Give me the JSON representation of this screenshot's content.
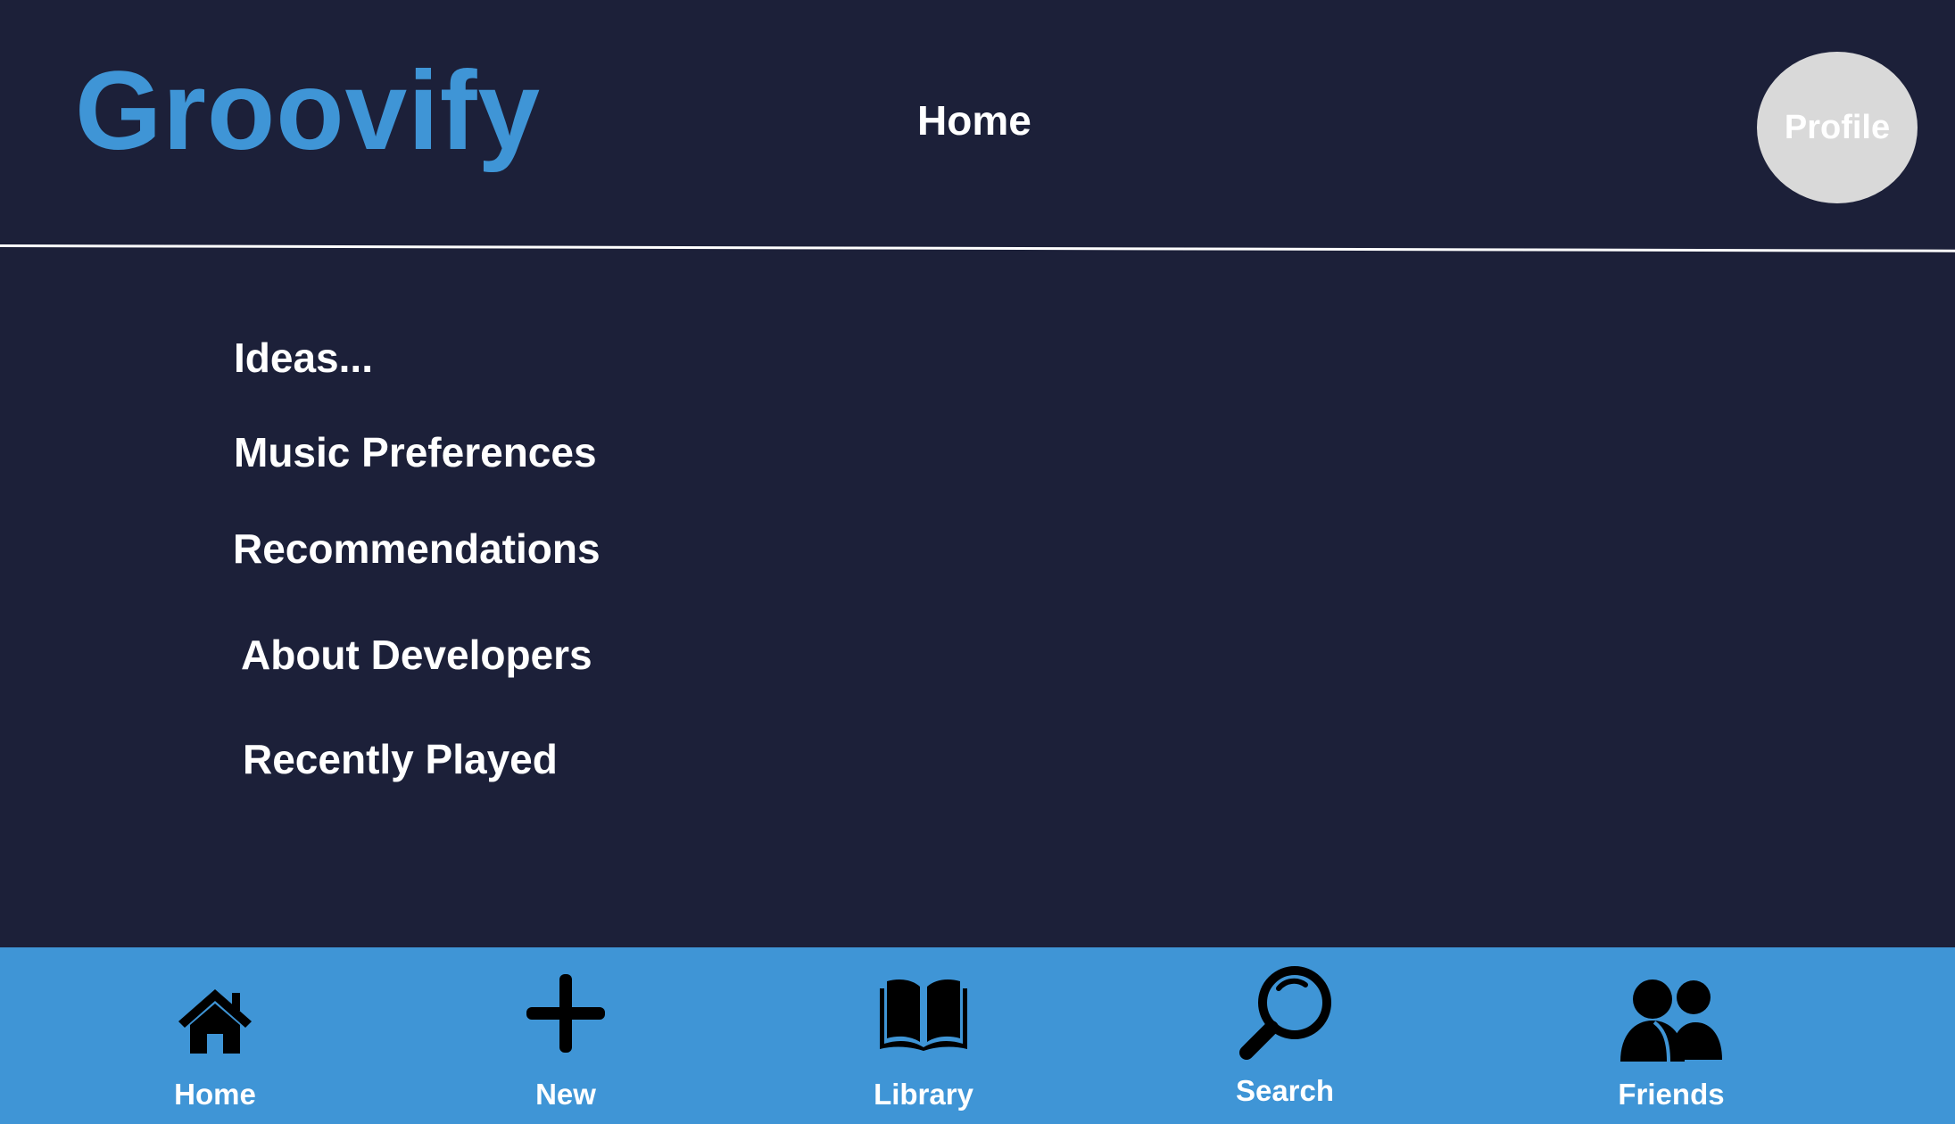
{
  "header": {
    "brand": "Groovify",
    "page_title": "Home",
    "profile_label": "Profile"
  },
  "menu": {
    "items": [
      {
        "label": "Ideas..."
      },
      {
        "label": "Music Preferences"
      },
      {
        "label": "Recommendations"
      },
      {
        "label": "About Developers"
      },
      {
        "label": "Recently Played"
      }
    ]
  },
  "bottom_nav": {
    "items": [
      {
        "label": "Home",
        "icon": "home-icon"
      },
      {
        "label": "New",
        "icon": "plus-icon"
      },
      {
        "label": "Library",
        "icon": "book-icon"
      },
      {
        "label": "Search",
        "icon": "search-icon"
      },
      {
        "label": "Friends",
        "icon": "friends-icon"
      }
    ]
  },
  "colors": {
    "background": "#1c2039",
    "accent": "#3f95d6",
    "text": "#ffffff",
    "profile_bg": "#d9d9d9"
  }
}
